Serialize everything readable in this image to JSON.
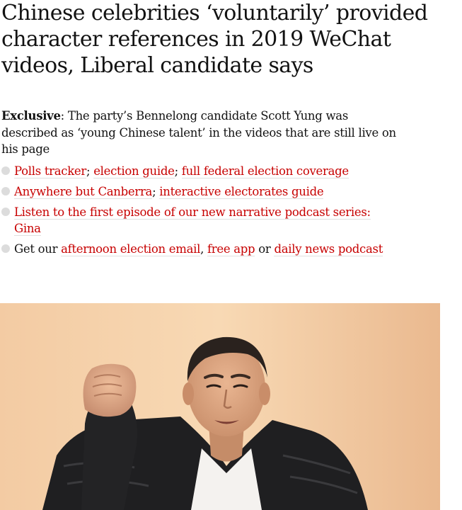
{
  "article": {
    "headline": "Chinese celebrities ‘voluntarily’ provided character references in 2019 WeChat videos, Liberal candidate says",
    "standfirst": {
      "lead": "Exclusive",
      "text": ": The party’s Bennelong candidate Scott Yung was described as ‘young Chinese talent’ in the videos that are still live on his page"
    },
    "bullets": [
      {
        "links": [
          "Polls tracker",
          "election guide",
          "full federal election coverage"
        ],
        "sep1": "; ",
        "sep2": "; "
      },
      {
        "links": [
          "Anywhere but Canberra",
          "interactive electorates guide"
        ],
        "sep1": "; "
      },
      {
        "links": [
          "Listen to the first episode of our new narrative podcast series: Gina"
        ]
      },
      {
        "prefix": "Get our ",
        "links": [
          "afternoon election email",
          "free app",
          "daily news podcast"
        ],
        "sep1": ", ",
        "sep2": " or "
      }
    ]
  },
  "colors": {
    "link": "#c70000",
    "text": "#121212",
    "bullet": "#dcdcdc",
    "photo_background": "#f4cfa8"
  },
  "image": {
    "subject": "man-raising-fist-photo"
  }
}
